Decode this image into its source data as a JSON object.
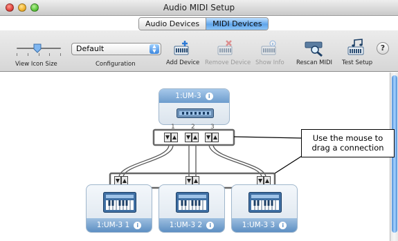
{
  "window": {
    "title": "Audio MIDI Setup"
  },
  "tabs": [
    {
      "label": "Audio Devices",
      "active": false
    },
    {
      "label": "MIDI Devices",
      "active": true
    }
  ],
  "toolbar": {
    "view_icon_size_label": "View Icon Size",
    "configuration_label": "Configuration",
    "configuration_value": "Default",
    "add_device_label": "Add Device",
    "remove_device_label": "Remove Device",
    "show_info_label": "Show Info",
    "rescan_midi_label": "Rescan MIDI",
    "test_setup_label": "Test Setup",
    "help_label": "?"
  },
  "interface": {
    "name": "1:UM-3",
    "ports": [
      "1",
      "2",
      "3"
    ]
  },
  "devices": [
    {
      "name": "1:UM-3 1"
    },
    {
      "name": "1:UM-3 2"
    },
    {
      "name": "1:UM-3 3"
    }
  ],
  "callout": {
    "line1": "Use the mouse to",
    "line2": "drag a connection"
  },
  "colors": {
    "accent_blue": "#5d8fc3",
    "tab_active": "#5fa4ea",
    "connection_box": "#555555"
  }
}
